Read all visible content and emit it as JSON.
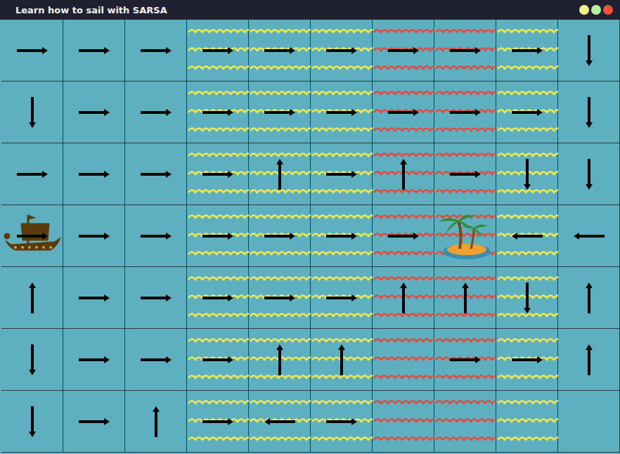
{
  "window": {
    "title": "Learn how to sail with SARSA",
    "buttons": [
      {
        "color": "#f3ee8a"
      },
      {
        "color": "#b9efa2"
      },
      {
        "color": "#f0503c"
      }
    ]
  },
  "grid": [
    [
      {
        "kind": "calm",
        "arrow": "right",
        "occupant": "none"
      },
      {
        "kind": "calm",
        "arrow": "right",
        "occupant": "none"
      },
      {
        "kind": "calm",
        "arrow": "right",
        "occupant": "none"
      },
      {
        "kind": "yellow-waves",
        "arrow": "right",
        "occupant": "none"
      },
      {
        "kind": "yellow-waves",
        "arrow": "right",
        "occupant": "none"
      },
      {
        "kind": "yellow-waves",
        "arrow": "right",
        "occupant": "none"
      },
      {
        "kind": "red-waves",
        "arrow": "right",
        "occupant": "none"
      },
      {
        "kind": "red-waves",
        "arrow": "right",
        "occupant": "none"
      },
      {
        "kind": "yellow-waves",
        "arrow": "right",
        "occupant": "none"
      },
      {
        "kind": "calm",
        "arrow": "down",
        "occupant": "none"
      }
    ],
    [
      {
        "kind": "calm",
        "arrow": "down",
        "occupant": "none"
      },
      {
        "kind": "calm",
        "arrow": "right",
        "occupant": "none"
      },
      {
        "kind": "calm",
        "arrow": "right",
        "occupant": "none"
      },
      {
        "kind": "yellow-waves",
        "arrow": "right",
        "occupant": "none"
      },
      {
        "kind": "yellow-waves",
        "arrow": "right",
        "occupant": "none"
      },
      {
        "kind": "yellow-waves",
        "arrow": "right",
        "occupant": "none"
      },
      {
        "kind": "red-waves",
        "arrow": "right",
        "occupant": "none"
      },
      {
        "kind": "red-waves",
        "arrow": "right",
        "occupant": "none"
      },
      {
        "kind": "yellow-waves",
        "arrow": "right",
        "occupant": "none"
      },
      {
        "kind": "calm",
        "arrow": "down",
        "occupant": "none"
      }
    ],
    [
      {
        "kind": "calm",
        "arrow": "right",
        "occupant": "none"
      },
      {
        "kind": "calm",
        "arrow": "right",
        "occupant": "none"
      },
      {
        "kind": "calm",
        "arrow": "right",
        "occupant": "none"
      },
      {
        "kind": "yellow-waves",
        "arrow": "right",
        "occupant": "none"
      },
      {
        "kind": "yellow-waves",
        "arrow": "up",
        "occupant": "none"
      },
      {
        "kind": "yellow-waves",
        "arrow": "right",
        "occupant": "none"
      },
      {
        "kind": "red-waves",
        "arrow": "up",
        "occupant": "none"
      },
      {
        "kind": "red-waves",
        "arrow": "right",
        "occupant": "none"
      },
      {
        "kind": "yellow-waves",
        "arrow": "down",
        "occupant": "none"
      },
      {
        "kind": "calm",
        "arrow": "down",
        "occupant": "none"
      }
    ],
    [
      {
        "kind": "calm",
        "arrow": "right",
        "occupant": "ship"
      },
      {
        "kind": "calm",
        "arrow": "right",
        "occupant": "none"
      },
      {
        "kind": "calm",
        "arrow": "right",
        "occupant": "none"
      },
      {
        "kind": "yellow-waves",
        "arrow": "right",
        "occupant": "none"
      },
      {
        "kind": "yellow-waves",
        "arrow": "right",
        "occupant": "none"
      },
      {
        "kind": "yellow-waves",
        "arrow": "right",
        "occupant": "none"
      },
      {
        "kind": "red-waves",
        "arrow": "right",
        "occupant": "none"
      },
      {
        "kind": "red-waves",
        "arrow": "none",
        "occupant": "island"
      },
      {
        "kind": "yellow-waves",
        "arrow": "left",
        "occupant": "none"
      },
      {
        "kind": "calm",
        "arrow": "left",
        "occupant": "none"
      }
    ],
    [
      {
        "kind": "calm",
        "arrow": "up",
        "occupant": "none"
      },
      {
        "kind": "calm",
        "arrow": "right",
        "occupant": "none"
      },
      {
        "kind": "calm",
        "arrow": "right",
        "occupant": "none"
      },
      {
        "kind": "yellow-waves",
        "arrow": "right",
        "occupant": "none"
      },
      {
        "kind": "yellow-waves",
        "arrow": "right",
        "occupant": "none"
      },
      {
        "kind": "yellow-waves",
        "arrow": "right",
        "occupant": "none"
      },
      {
        "kind": "red-waves",
        "arrow": "up",
        "occupant": "none"
      },
      {
        "kind": "red-waves",
        "arrow": "up",
        "occupant": "none"
      },
      {
        "kind": "yellow-waves",
        "arrow": "down",
        "occupant": "none"
      },
      {
        "kind": "calm",
        "arrow": "up",
        "occupant": "none"
      }
    ],
    [
      {
        "kind": "calm",
        "arrow": "down",
        "occupant": "none"
      },
      {
        "kind": "calm",
        "arrow": "right",
        "occupant": "none"
      },
      {
        "kind": "calm",
        "arrow": "right",
        "occupant": "none"
      },
      {
        "kind": "yellow-waves",
        "arrow": "right",
        "occupant": "none"
      },
      {
        "kind": "yellow-waves",
        "arrow": "up",
        "occupant": "none"
      },
      {
        "kind": "yellow-waves",
        "arrow": "up",
        "occupant": "none"
      },
      {
        "kind": "red-waves",
        "arrow": "none",
        "occupant": "none"
      },
      {
        "kind": "red-waves",
        "arrow": "right",
        "occupant": "none"
      },
      {
        "kind": "yellow-waves",
        "arrow": "right",
        "occupant": "none"
      },
      {
        "kind": "calm",
        "arrow": "up",
        "occupant": "none"
      }
    ],
    [
      {
        "kind": "calm",
        "arrow": "down",
        "occupant": "none"
      },
      {
        "kind": "calm",
        "arrow": "right",
        "occupant": "none"
      },
      {
        "kind": "calm",
        "arrow": "up",
        "occupant": "none"
      },
      {
        "kind": "yellow-waves",
        "arrow": "right",
        "occupant": "none"
      },
      {
        "kind": "yellow-waves",
        "arrow": "left",
        "occupant": "none"
      },
      {
        "kind": "yellow-waves",
        "arrow": "right",
        "occupant": "none"
      },
      {
        "kind": "red-waves",
        "arrow": "none",
        "occupant": "none"
      },
      {
        "kind": "red-waves",
        "arrow": "none",
        "occupant": "none"
      },
      {
        "kind": "yellow-waves",
        "arrow": "none",
        "occupant": "none"
      },
      {
        "kind": "calm",
        "arrow": "none",
        "occupant": "none"
      }
    ]
  ]
}
